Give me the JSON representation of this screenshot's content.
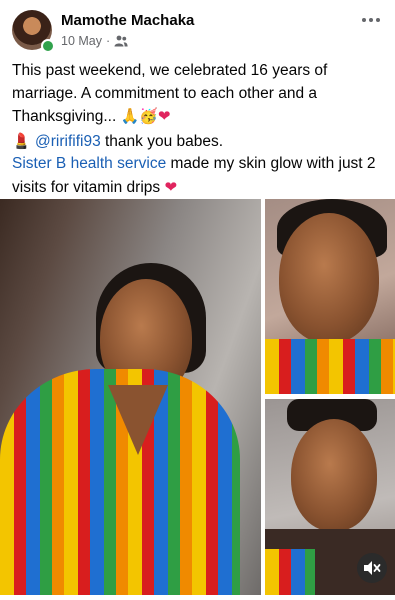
{
  "post": {
    "author": "Mamothe Machaka",
    "date": "10 May",
    "separator": "·",
    "privacy_icon": "friends-icon",
    "more_icon": "more-horizontal-icon",
    "online": true
  },
  "body": {
    "line1": "This past weekend, we celebrated 16 years of marriage. A commitment to each other and a Thanksgiving...",
    "line1_emojis": "🙏🥳",
    "line1_heart": "❤",
    "lipstick": "💄",
    "mention": "@rirififi93",
    "mention_suffix": " thank you babes.",
    "service_link": "Sister B health service",
    "service_text": " made my skin glow with just 2 visits for vitamin drips",
    "service_heart": "❤"
  },
  "media": {
    "mute_icon": "speaker-muted-icon"
  },
  "colors": {
    "link": "#1a5fb4",
    "meta": "#65676b",
    "online": "#31a24c",
    "heart": "#e0245e"
  }
}
